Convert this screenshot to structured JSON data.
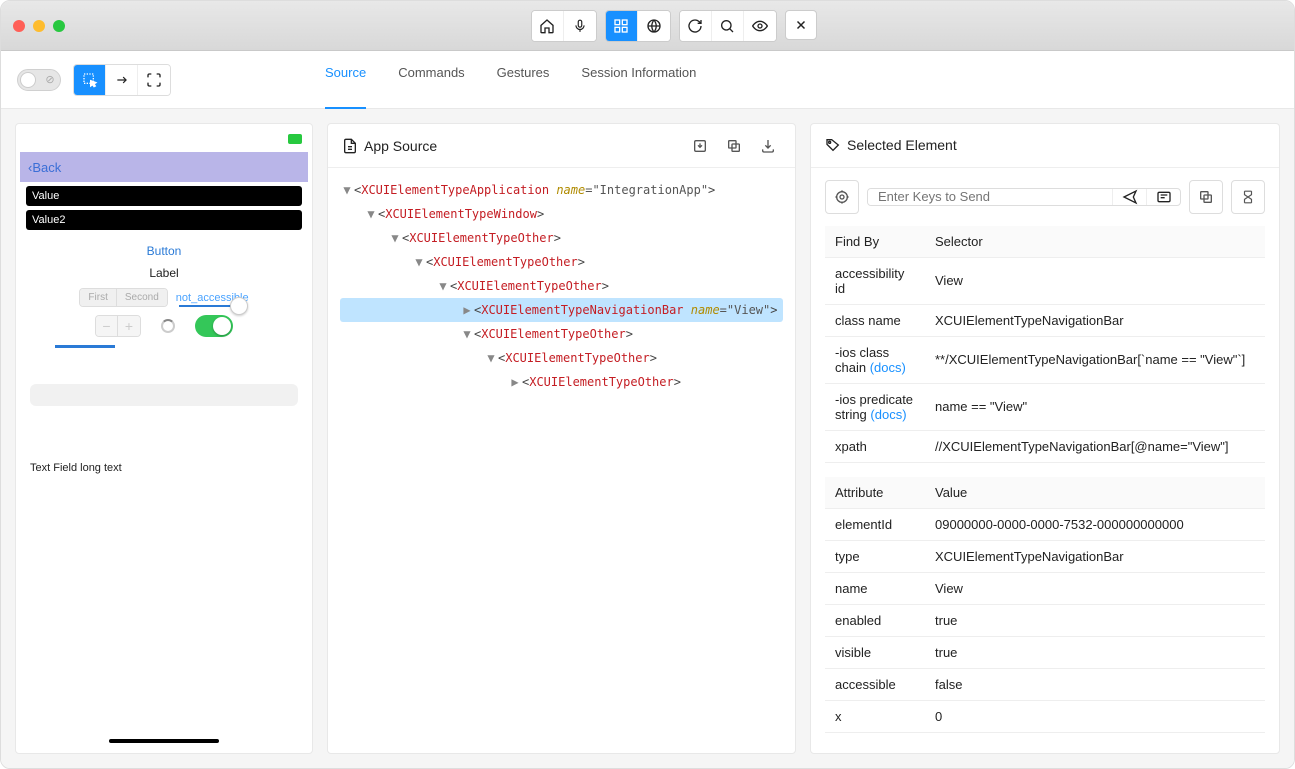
{
  "titlebar": {
    "home_icon": "home-icon",
    "mic_icon": "mic-icon",
    "grid_icon": "grid-icon",
    "globe_icon": "globe-icon",
    "refresh_icon": "refresh-icon",
    "search_icon": "search-icon",
    "eye_icon": "eye-icon",
    "close_icon": "close-icon"
  },
  "toolbar": {
    "select_tool": "inspect-icon",
    "swipe_tool": "swipe-icon",
    "expand_tool": "expand-icon"
  },
  "tabs": [
    "Source",
    "Commands",
    "Gestures",
    "Session Information"
  ],
  "active_tab": "Source",
  "preview": {
    "back_label": "Back",
    "value1": "Value",
    "value2": "Value2",
    "button_label": "Button",
    "label_label": "Label",
    "not_accessible": "not_accessible",
    "seg_first": "First",
    "seg_second": "Second",
    "textfield_label": "Text Field long text"
  },
  "source_panel": {
    "title": "App Source",
    "tree": [
      {
        "indent": 0,
        "caret": "down",
        "tag": "XCUIElementTypeApplication",
        "attr": "name",
        "val": "IntegrationApp"
      },
      {
        "indent": 1,
        "caret": "down",
        "tag": "XCUIElementTypeWindow"
      },
      {
        "indent": 2,
        "caret": "down",
        "tag": "XCUIElementTypeOther"
      },
      {
        "indent": 3,
        "caret": "down",
        "tag": "XCUIElementTypeOther"
      },
      {
        "indent": 4,
        "caret": "down",
        "tag": "XCUIElementTypeOther"
      },
      {
        "indent": 5,
        "caret": "right",
        "tag": "XCUIElementTypeNavigationBar",
        "attr": "name",
        "val": "View",
        "selected": true
      },
      {
        "indent": 5,
        "caret": "down",
        "tag": "XCUIElementTypeOther"
      },
      {
        "indent": 6,
        "caret": "down",
        "tag": "XCUIElementTypeOther"
      },
      {
        "indent": 7,
        "caret": "right",
        "tag": "XCUIElementTypeOther"
      }
    ]
  },
  "selected_panel": {
    "title": "Selected Element",
    "send_placeholder": "Enter Keys to Send",
    "locator_headers": [
      "Find By",
      "Selector"
    ],
    "locators": [
      {
        "by": "accessibility id",
        "sel": "View"
      },
      {
        "by": "class name",
        "sel": "XCUIElementTypeNavigationBar"
      },
      {
        "by": "-ios class chain",
        "docs": true,
        "sel": "**/XCUIElementTypeNavigationBar[`name == \"View\"`]"
      },
      {
        "by": "-ios predicate string",
        "docs": true,
        "sel": "name == \"View\""
      },
      {
        "by": "xpath",
        "sel": "//XCUIElementTypeNavigationBar[@name=\"View\"]"
      }
    ],
    "docs_label": "(docs)",
    "attr_headers": [
      "Attribute",
      "Value"
    ],
    "attrs": [
      {
        "k": "elementId",
        "v": "09000000-0000-0000-7532-000000000000"
      },
      {
        "k": "type",
        "v": "XCUIElementTypeNavigationBar"
      },
      {
        "k": "name",
        "v": "View"
      },
      {
        "k": "enabled",
        "v": "true"
      },
      {
        "k": "visible",
        "v": "true"
      },
      {
        "k": "accessible",
        "v": "false"
      },
      {
        "k": "x",
        "v": "0"
      }
    ]
  }
}
